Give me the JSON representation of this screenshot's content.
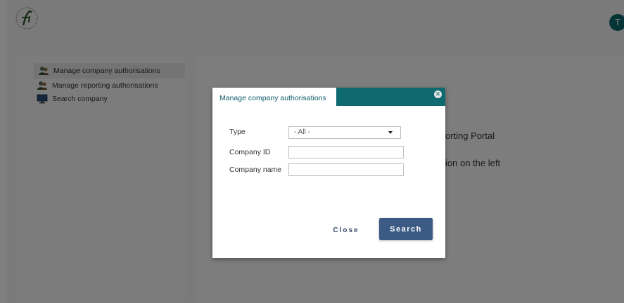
{
  "header": {
    "avatar_initial": "T"
  },
  "sidebar": {
    "items": [
      {
        "label": "Manage company authorisations",
        "icon": "people-icon",
        "active": true
      },
      {
        "label": "Manage reporting authorisations",
        "icon": "people-icon",
        "active": false
      },
      {
        "label": "Search company",
        "icon": "monitor-icon",
        "active": false
      }
    ]
  },
  "main": {
    "welcome_fragment": "orting Portal",
    "instruction_fragment": "ion on the left"
  },
  "dialog": {
    "title": "Manage company authorisations",
    "fields": {
      "type_label": "Type",
      "type_value": "- All -",
      "company_id_label": "Company ID",
      "company_id_value": "",
      "company_name_label": "Company name",
      "company_name_value": ""
    },
    "close_label": "Close",
    "search_label": "Search"
  },
  "colors": {
    "accent": "#0e6a6f",
    "primary_button": "#3b5a84"
  }
}
